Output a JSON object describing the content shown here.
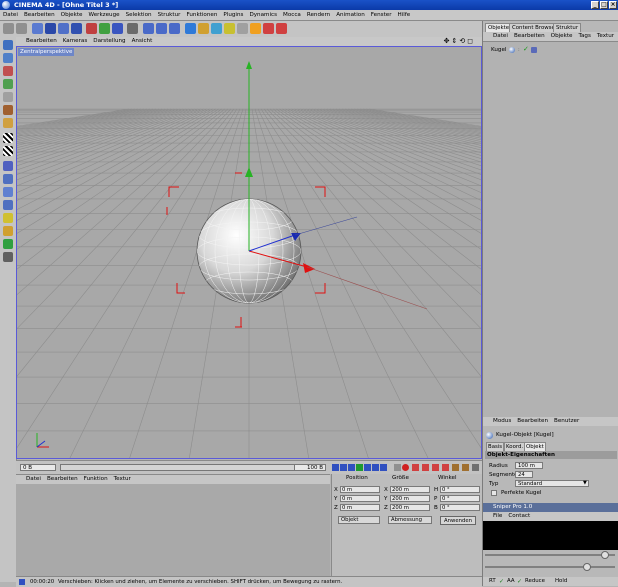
{
  "app": {
    "title": "CINEMA 4D - [Ohne Titel 3 *]"
  },
  "menubar": [
    "Datei",
    "Bearbeiten",
    "Objekte",
    "Werkzeuge",
    "Selektion",
    "Struktur",
    "Funktionen",
    "Plugins",
    "Dynamics",
    "Mocca",
    "Rendern",
    "Animation",
    "Fenster",
    "Hilfe"
  ],
  "viewport": {
    "menu": [
      "Bearbeiten",
      "Kameras",
      "Darstellung",
      "Ansicht"
    ],
    "label": "Zentralperspektive"
  },
  "timeline": {
    "current_frame": "0 B",
    "end_frame": "100 B"
  },
  "material_panel": {
    "menu": [
      "Datei",
      "Bearbeiten",
      "Funktion",
      "Textur"
    ]
  },
  "coordinates": {
    "headers": [
      "Position",
      "Größe",
      "Winkel"
    ],
    "rows": [
      {
        "axis": "X",
        "pos": "0 m",
        "size_axis": "X",
        "size": "200 m",
        "rot_axis": "H",
        "rot": "0 °"
      },
      {
        "axis": "Y",
        "pos": "0 m",
        "size_axis": "Y",
        "size": "200 m",
        "rot_axis": "P",
        "rot": "0 °"
      },
      {
        "axis": "Z",
        "pos": "0 m",
        "size_axis": "Z",
        "size": "200 m",
        "rot_axis": "B",
        "rot": "0 °"
      }
    ],
    "mode_select": "Objekt",
    "size_select": "Abmessung",
    "apply_label": "Anwenden"
  },
  "right_panel": {
    "tabs": [
      "Objekte",
      "Content Browser",
      "Struktur"
    ],
    "object_menu": [
      "Datei",
      "Bearbeiten",
      "Objekte",
      "Tags",
      "Textur"
    ],
    "object_item": "Kugel",
    "attr_menu": [
      "Modus",
      "Bearbeiten",
      "Benutzer"
    ],
    "attr_object": "Kugel-Objekt [Kugel]",
    "attr_tabs": [
      "Basis",
      "Koord.",
      "Objekt"
    ],
    "props_heading": "Objekt-Eigenschaften",
    "props": {
      "radius_label": "Radius",
      "radius": "100 m",
      "segments_label": "Segmente",
      "segments": "24",
      "type_label": "Typ",
      "type": "Standard",
      "perfect_label": "Perfekte Kugel"
    },
    "sniper_title": "Sniper Pro 1.0",
    "sniper_menu": [
      "File",
      "Contact"
    ],
    "sniper_options": {
      "rt": "RT",
      "aa": "AA",
      "reduce": "Reduce",
      "hold": "Hold"
    }
  },
  "status": {
    "time": "00:00:20",
    "message": "Verschieben: Klicken und ziehen, um Elemente zu verschieben. SHIFT drücken, um Bewegung zu rastern."
  },
  "colors": {
    "title_bar": "#0b3aa8",
    "viewport_bg": "#a8a8a8",
    "axis_y": "#27b324",
    "axis_x": "#e01010",
    "axis_z": "#2030d0",
    "bbox": "#e01010"
  }
}
